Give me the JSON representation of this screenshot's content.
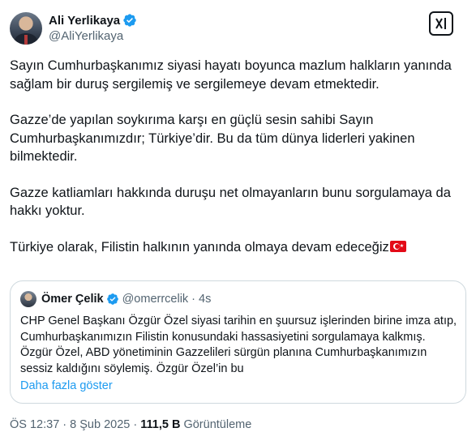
{
  "author": {
    "display_name": "Ali Yerlikaya",
    "handle": "@AliYerlikaya"
  },
  "tweet": {
    "paragraphs": [
      "Sayın Cumhurbaşkanımız siyasi hayatı boyunca mazlum halkların yanında sağlam bir duruş sergilemiş ve sergilemeye devam etmektedir.",
      "Gazze’de yapılan soykırıma karşı en güçlü sesin sahibi Sayın Cumhurbaşkanımızdır; Türkiye’dir. Bu da tüm dünya liderleri yakinen bilmektedir.",
      "Gazze katliamları hakkında duruşu net olmayanların bunu sorgulamaya da hakkı yoktur.",
      "Türkiye olarak, Filistin halkının yanında olmaya devam edeceğiz"
    ]
  },
  "quote": {
    "display_name": "Ömer Çelik",
    "handle": "@omerrcelik",
    "separator": "·",
    "time": "4s",
    "text": "CHP Genel Başkanı Özgür Özel siyasi tarihin en şuursuz işlerinden birine imza atıp, Cumhurbaşkanımızın Filistin konusundaki hassasiyetini sorgulamaya kalkmış. Özgür Özel, ABD yönetiminin Gazzelileri sürgün planına Cumhurbaşkanımızın sessiz kaldığını söylemiş. Özgür Özel’in bu",
    "show_more": "Daha fazla göster"
  },
  "meta": {
    "time": "ÖS 12:37",
    "separator": "·",
    "date": "8 Şub 2025",
    "views": "111,5 B",
    "views_label": "Görüntüleme"
  },
  "icons": {
    "verified": "verified-badge-icon",
    "grok": "grok-icon",
    "flag": "turkey-flag-emoji"
  },
  "colors": {
    "verified": "#1d9bf0",
    "link": "#1d9bf0",
    "secondary_text": "#536471"
  }
}
